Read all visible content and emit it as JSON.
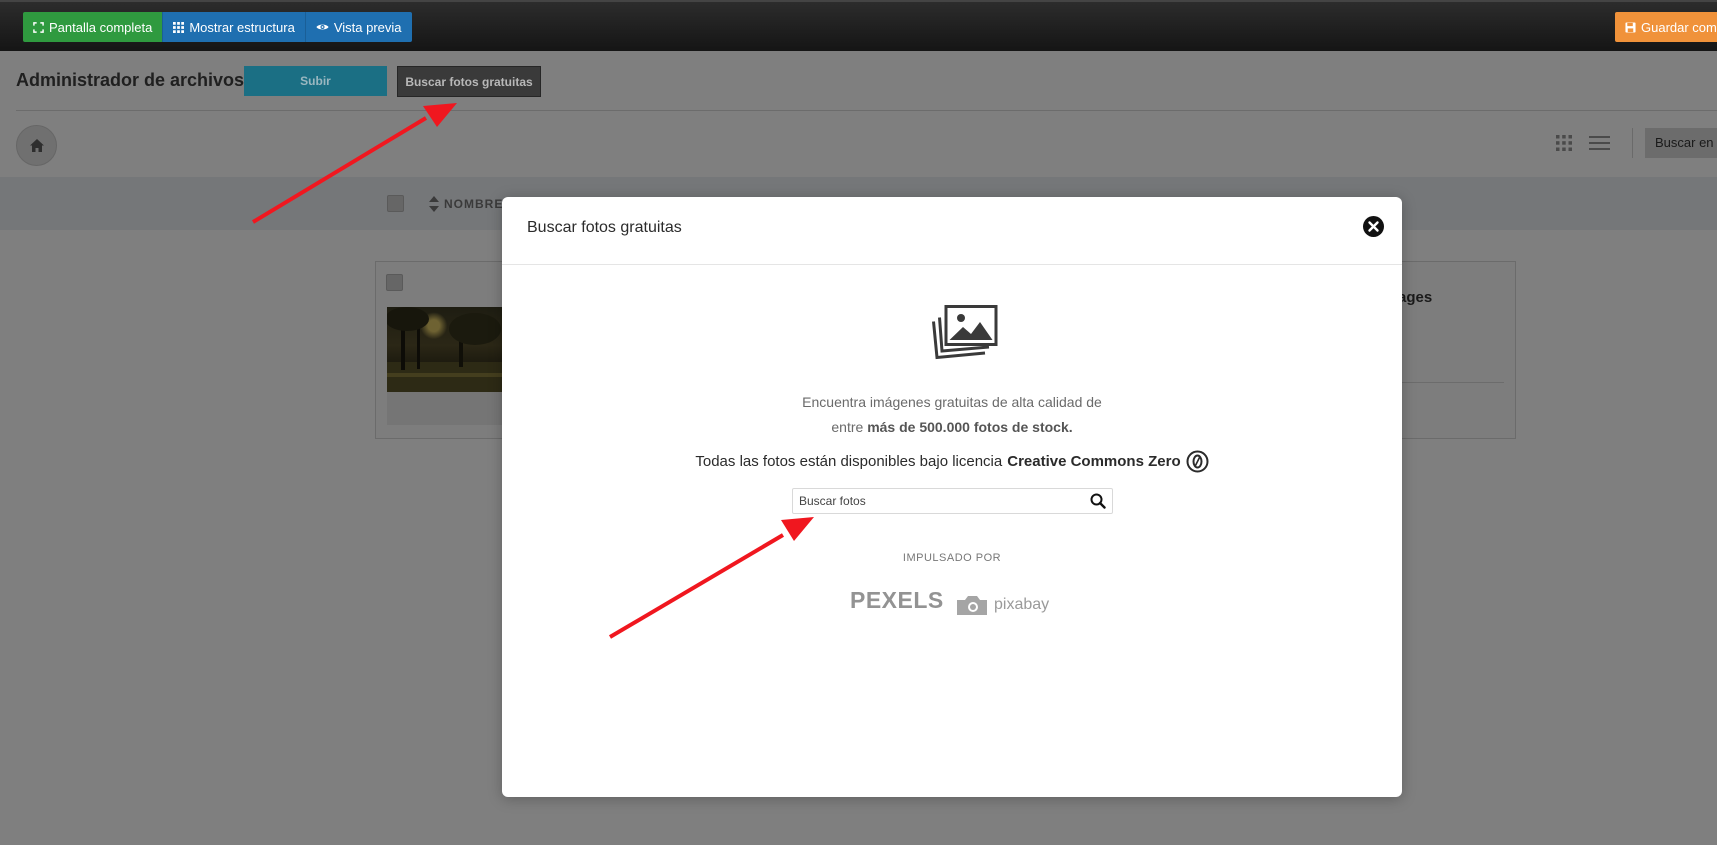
{
  "toolbar": {
    "fullscreen_label": "Pantalla completa",
    "structure_label": "Mostrar estructura",
    "preview_label": "Vista previa",
    "save_label": "Guardar como"
  },
  "file_manager": {
    "title": "Administrador de archivos",
    "upload_label": "Subir",
    "free_photos_label": "Buscar fotos gratuitas",
    "search_label": "Buscar en",
    "column_name": "NOMBRE",
    "item_label": "ages"
  },
  "modal": {
    "title": "Buscar fotos gratuitas",
    "desc_line1": "Encuentra imágenes gratuitas de alta calidad de",
    "desc_line2_prefix": "entre ",
    "desc_line2_bold": "más de 500.000 fotos de stock.",
    "license_prefix": "Todas las fotos están disponibles bajo licencia ",
    "license_bold": "Creative Commons Zero",
    "search_placeholder": "Buscar fotos",
    "powered_by": "IMPULSADO POR",
    "pexels_logo": "PEXELS",
    "pixabay_logo": "pixabay"
  },
  "colors": {
    "green": "#2f9a3f",
    "blue": "#1f6fb0",
    "orange": "#f0923a",
    "arrow_red": "#f0171f"
  }
}
